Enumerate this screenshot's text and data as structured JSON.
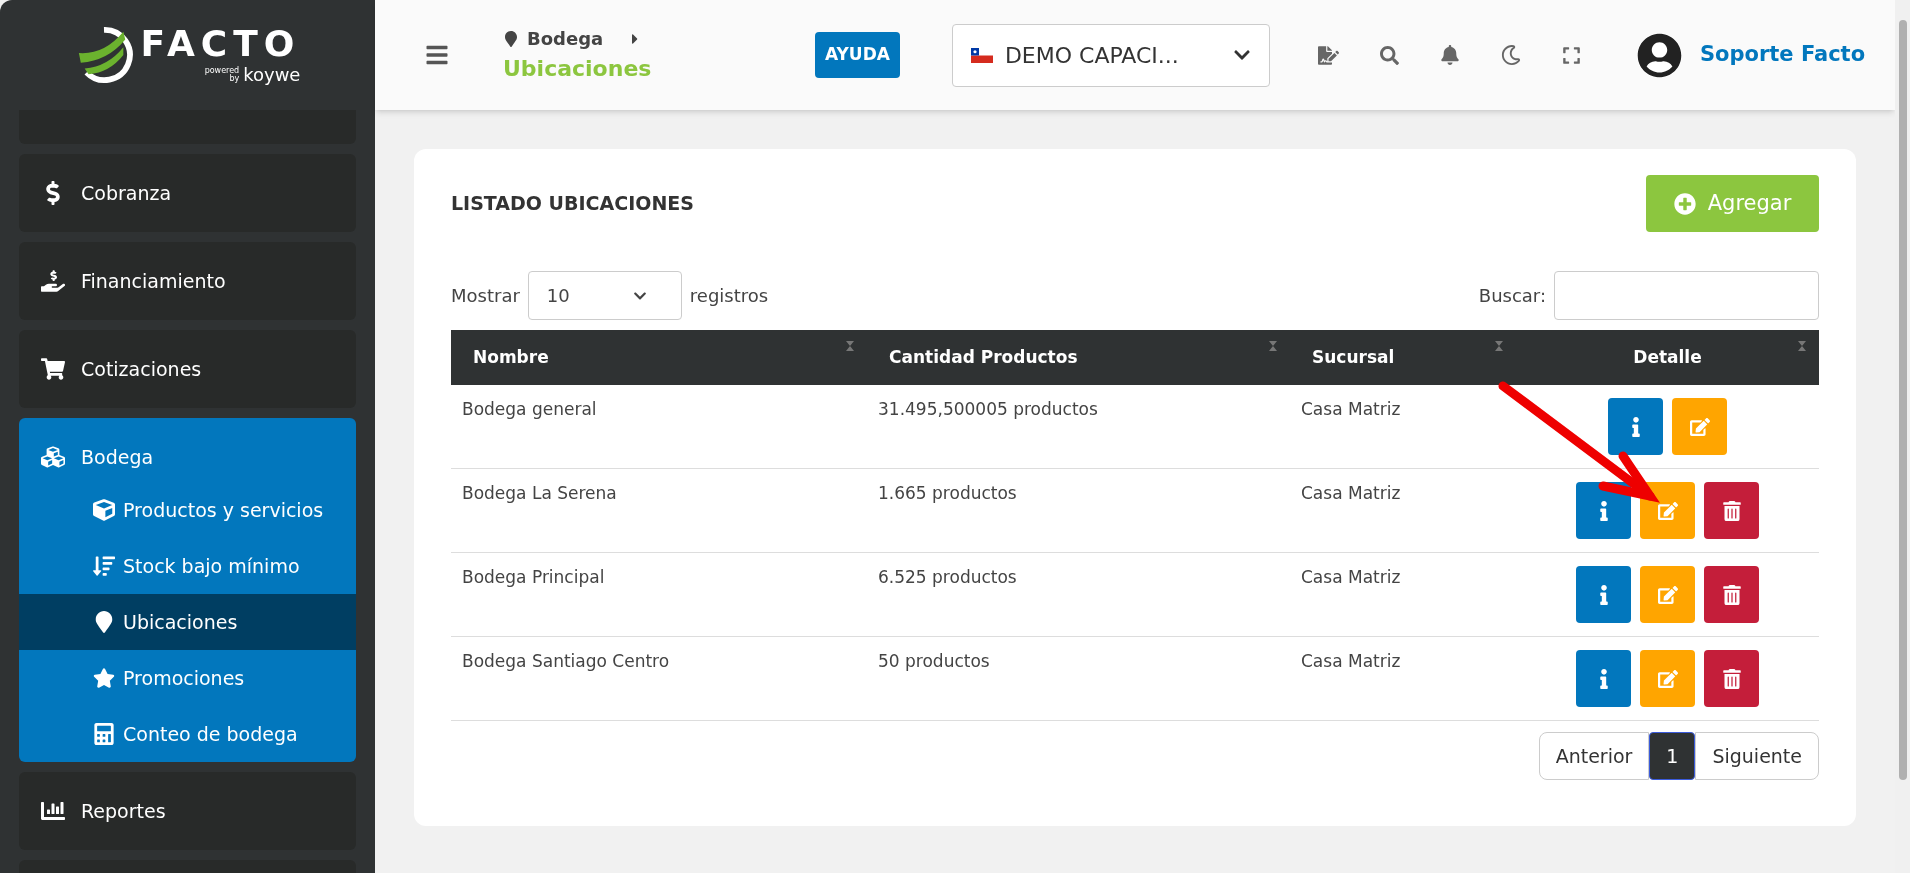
{
  "logo": {
    "name": "FACTO",
    "powered": "powered",
    "by": "by",
    "brand": "koywe"
  },
  "sidebar": {
    "items": [
      {
        "label": "Cobranza",
        "expanded": false
      },
      {
        "label": "Financiamiento",
        "expanded": false
      },
      {
        "label": "Cotizaciones",
        "expanded": false
      },
      {
        "label": "Bodega",
        "expanded": true,
        "children": [
          {
            "label": "Productos y servicios",
            "selected": false
          },
          {
            "label": "Stock bajo mínimo",
            "selected": false
          },
          {
            "label": "Ubicaciones",
            "selected": true
          },
          {
            "label": "Promociones",
            "selected": false
          },
          {
            "label": "Conteo de bodega",
            "selected": false
          }
        ]
      },
      {
        "label": "Reportes",
        "expanded": false
      }
    ]
  },
  "header": {
    "breadcrumb": {
      "parent": "Bodega",
      "current": "Ubicaciones"
    },
    "help": "AYUDA",
    "company": "DEMO CAPACI...",
    "user": "Soporte Facto"
  },
  "card": {
    "title": "LISTADO UBICACIONES",
    "add_button": "Agregar",
    "length": {
      "before": "Mostrar",
      "value": "10",
      "after": "registros"
    },
    "search": {
      "label": "Buscar:"
    },
    "table": {
      "columns": [
        "Nombre",
        "Cantidad Productos",
        "Sucursal",
        "Detalle"
      ],
      "rows": [
        {
          "cells": [
            "Bodega general",
            "31.495,500005 productos",
            "Casa Matriz"
          ],
          "actions": [
            {
              "kind": "info"
            },
            {
              "kind": "edit"
            }
          ]
        },
        {
          "cells": [
            "Bodega La Serena",
            "1.665 productos",
            "Casa Matriz"
          ],
          "actions": [
            {
              "kind": "info"
            },
            {
              "kind": "edit"
            },
            {
              "kind": "delete"
            }
          ]
        },
        {
          "cells": [
            "Bodega Principal",
            "6.525 productos",
            "Casa Matriz"
          ],
          "actions": [
            {
              "kind": "info"
            },
            {
              "kind": "edit"
            },
            {
              "kind": "delete"
            }
          ]
        },
        {
          "cells": [
            "Bodega Santiago Centro",
            "50 productos",
            "Casa Matriz"
          ],
          "actions": [
            {
              "kind": "info"
            },
            {
              "kind": "edit"
            },
            {
              "kind": "delete"
            }
          ]
        }
      ]
    },
    "pagination": {
      "previous": "Anterior",
      "pages": [
        {
          "label": "1",
          "selected": true
        }
      ],
      "next": "Siguiente"
    }
  }
}
